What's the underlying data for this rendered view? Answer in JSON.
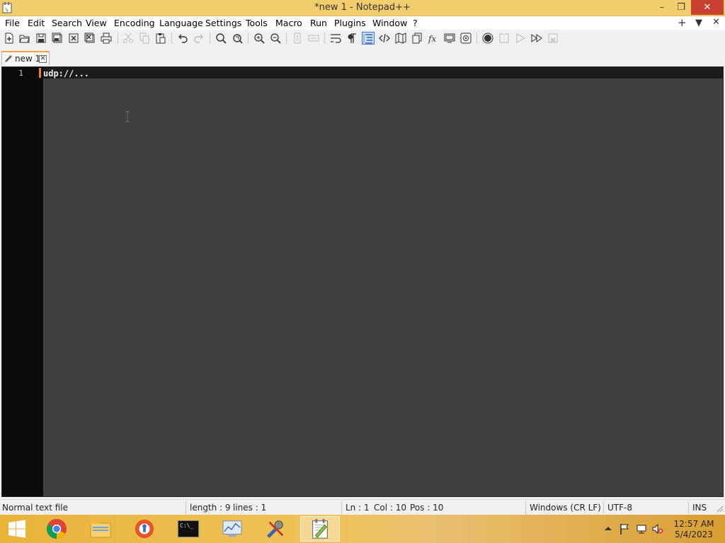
{
  "window": {
    "title": "*new 1 - Notepad++",
    "minimize_symbol": "–",
    "restore_symbol": "❐",
    "close_symbol": "✕"
  },
  "menu": {
    "items": [
      "File",
      "Edit",
      "Search",
      "View",
      "Encoding",
      "Language",
      "Settings",
      "Tools",
      "Macro",
      "Run",
      "Plugins",
      "Window",
      "?"
    ],
    "right_controls": [
      "+",
      "▼",
      "✕"
    ]
  },
  "toolbar": {
    "icons": [
      "new-file-icon",
      "open-file-icon",
      "save-icon",
      "save-all-icon",
      "close-icon",
      "close-all-icon",
      "print-icon",
      "cut-icon",
      "copy-icon",
      "paste-icon",
      "undo-icon",
      "redo-icon",
      "find-icon",
      "replace-icon",
      "zoom-in-icon",
      "zoom-out-icon",
      "sync-vertical-icon",
      "sync-horizontal-icon",
      "word-wrap-icon",
      "show-all-chars-icon",
      "indent-guide-icon",
      "xml-tags-icon",
      "document-map-icon",
      "document-list-icon",
      "function-list-icon",
      "folder-as-workspace-icon",
      "monitoring-icon",
      "record-macro-icon",
      "stop-record-icon",
      "play-macro-icon",
      "run-macro-multiple-icon",
      "save-macro-icon"
    ],
    "selected": "indent-guide-icon"
  },
  "tabs": [
    {
      "label": "new 1",
      "close_symbol": "✕",
      "modified": true
    }
  ],
  "editor": {
    "line_numbers": [
      "1"
    ],
    "lines": [
      "udp://..."
    ]
  },
  "statusbar": {
    "file_type": "Normal text file",
    "length": "length : 9",
    "lines": "lines : 1",
    "ln": "Ln : 1",
    "col": "Col : 10",
    "pos": "Pos : 10",
    "eol": "Windows (CR LF)",
    "encoding": "UTF-8",
    "mode": "INS"
  },
  "taskbar": {
    "apps": [
      "windows-start-icon",
      "chrome-icon",
      "file-explorer-icon",
      "vpn-icon",
      "command-prompt-icon",
      "performance-monitor-icon",
      "tools-icon",
      "notepad-plus-plus-icon"
    ],
    "cmd_label": "C:\\_",
    "time": "12:57 AM",
    "date": "5/4/2023"
  },
  "colors": {
    "titlebar": "#f2cd6e",
    "editor_bg": "#404040",
    "gutter_bg": "#0b0b0b",
    "close_button": "#c84031",
    "accent_tab": "#f5a33a"
  }
}
